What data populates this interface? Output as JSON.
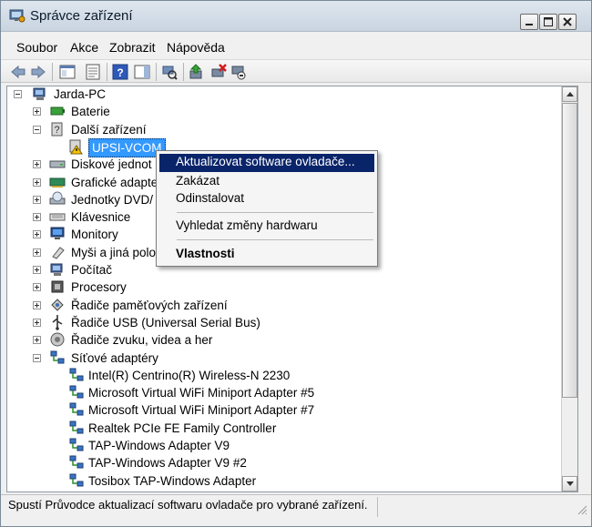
{
  "window": {
    "title": "Správce zařízení"
  },
  "menubar": {
    "items": [
      "Soubor",
      "Akce",
      "Zobrazit",
      "Nápověda"
    ]
  },
  "tree": {
    "root": "Jarda-PC",
    "nodes": [
      {
        "label": "Baterie",
        "expanded": false,
        "icon": "battery-icon"
      },
      {
        "label": "Další zařízení",
        "expanded": true,
        "icon": "unknown-device-icon",
        "children": [
          {
            "label": "UPSI-VCOM",
            "selected": true,
            "icon": "warning-device-icon"
          }
        ]
      },
      {
        "label": "Diskové jednot",
        "expanded": false,
        "icon": "disk-drive-icon"
      },
      {
        "label": "Grafické adapte",
        "expanded": false,
        "icon": "display-adapter-icon"
      },
      {
        "label": "Jednotky DVD/",
        "expanded": false,
        "icon": "dvd-drive-icon"
      },
      {
        "label": "Klávesnice",
        "expanded": false,
        "icon": "keyboard-icon"
      },
      {
        "label": "Monitory",
        "expanded": false,
        "icon": "monitor-icon"
      },
      {
        "label": "Myši a jiná polo",
        "expanded": false,
        "icon": "mouse-icon"
      },
      {
        "label": "Počítač",
        "expanded": false,
        "icon": "computer-icon"
      },
      {
        "label": "Procesory",
        "expanded": false,
        "icon": "processor-icon"
      },
      {
        "label": "Řadiče paměťových zařízení",
        "expanded": false,
        "icon": "storage-controller-icon"
      },
      {
        "label": "Řadiče USB (Universal Serial Bus)",
        "expanded": false,
        "icon": "usb-icon"
      },
      {
        "label": "Řadiče zvuku, videa a her",
        "expanded": false,
        "icon": "speaker-icon"
      },
      {
        "label": "Síťové adaptéry",
        "expanded": true,
        "icon": "network-adapter-icon",
        "children": [
          {
            "label": "Intel(R) Centrino(R) Wireless-N 2230",
            "icon": "network-adapter-icon"
          },
          {
            "label": "Microsoft Virtual WiFi Miniport Adapter #5",
            "icon": "network-adapter-icon"
          },
          {
            "label": "Microsoft Virtual WiFi Miniport Adapter #7",
            "icon": "network-adapter-icon"
          },
          {
            "label": "Realtek PCIe FE Family Controller",
            "icon": "network-adapter-icon"
          },
          {
            "label": "TAP-Windows Adapter V9",
            "icon": "network-adapter-icon"
          },
          {
            "label": "TAP-Windows Adapter V9 #2",
            "icon": "network-adapter-icon"
          },
          {
            "label": "Tosibox TAP-Windows Adapter",
            "icon": "network-adapter-icon"
          }
        ]
      }
    ]
  },
  "context_menu": {
    "items": [
      {
        "label": "Aktualizovat software ovladače...",
        "highlighted": true
      },
      {
        "label": "Zakázat"
      },
      {
        "label": "Odinstalovat"
      },
      {
        "label": "Vyhledat změny hardwaru"
      },
      {
        "label": "Vlastnosti",
        "bold": true
      }
    ]
  },
  "statusbar": {
    "text": "Spustí Průvodce aktualizací softwaru ovladače pro vybrané zařízení."
  },
  "colors": {
    "selection": "#3399ff",
    "menu_highlight": "#0a246a",
    "warning": "#f4c400"
  }
}
